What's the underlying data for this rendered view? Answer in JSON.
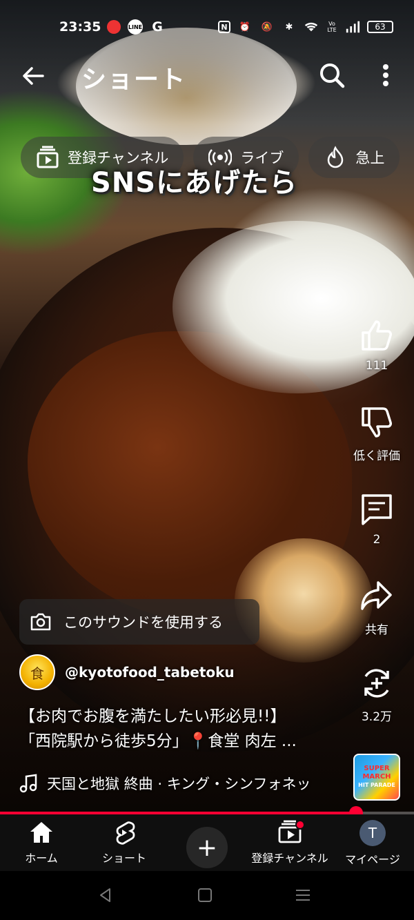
{
  "status_bar": {
    "time": "23:35",
    "battery": "63",
    "icons": [
      "avatar-badge-icon",
      "line-icon",
      "google-icon",
      "nfc-icon",
      "alarm-icon",
      "mute-icon",
      "bluetooth-icon",
      "wifi-icon",
      "volte-icon",
      "signal-icon",
      "battery-icon"
    ],
    "left_glyphs": {
      "line": "LINE",
      "g": "G"
    },
    "right_glyphs": {
      "nfc": "N",
      "alarm": "⏰",
      "mute": "🔕",
      "bluetooth": "✱",
      "volte": "Vo LTE"
    }
  },
  "header": {
    "title": "ショート"
  },
  "chips": [
    {
      "label": "登録チャンネル",
      "icon": "subscriptions-icon"
    },
    {
      "label": "ライブ",
      "icon": "live-icon"
    },
    {
      "label": "急上",
      "icon": "trending-icon"
    }
  ],
  "video_caption": "SNSにあげたら",
  "rail": {
    "like_count": "111",
    "dislike_label": "低く評価",
    "comment_count": "2",
    "share_label": "共有",
    "remix_count": "3.2万"
  },
  "sound_button": "このサウンドを使用する",
  "channel": {
    "handle": "@kyotofood_tabetoku",
    "avatar_text": "食"
  },
  "description": {
    "line1": "【お肉でお腹を満たしたい形必見!!】",
    "line2": "「西院駅から徒歩5分」📍食堂 肉左 ..."
  },
  "music": {
    "track": "天国と地獄 終曲 · キング・シンフォネッ",
    "album_art_text": [
      "SUPER",
      "MARCH",
      "HIT PARADE"
    ]
  },
  "progress": {
    "fraction": 0.86
  },
  "bottom_nav": {
    "home": "ホーム",
    "shorts": "ショート",
    "create": "+",
    "subscriptions": "登録チャンネル",
    "mypage": "マイページ",
    "mypage_initial": "T"
  },
  "colors": {
    "accent": "#ff0033",
    "nav_bg": "#0f0f0f"
  }
}
